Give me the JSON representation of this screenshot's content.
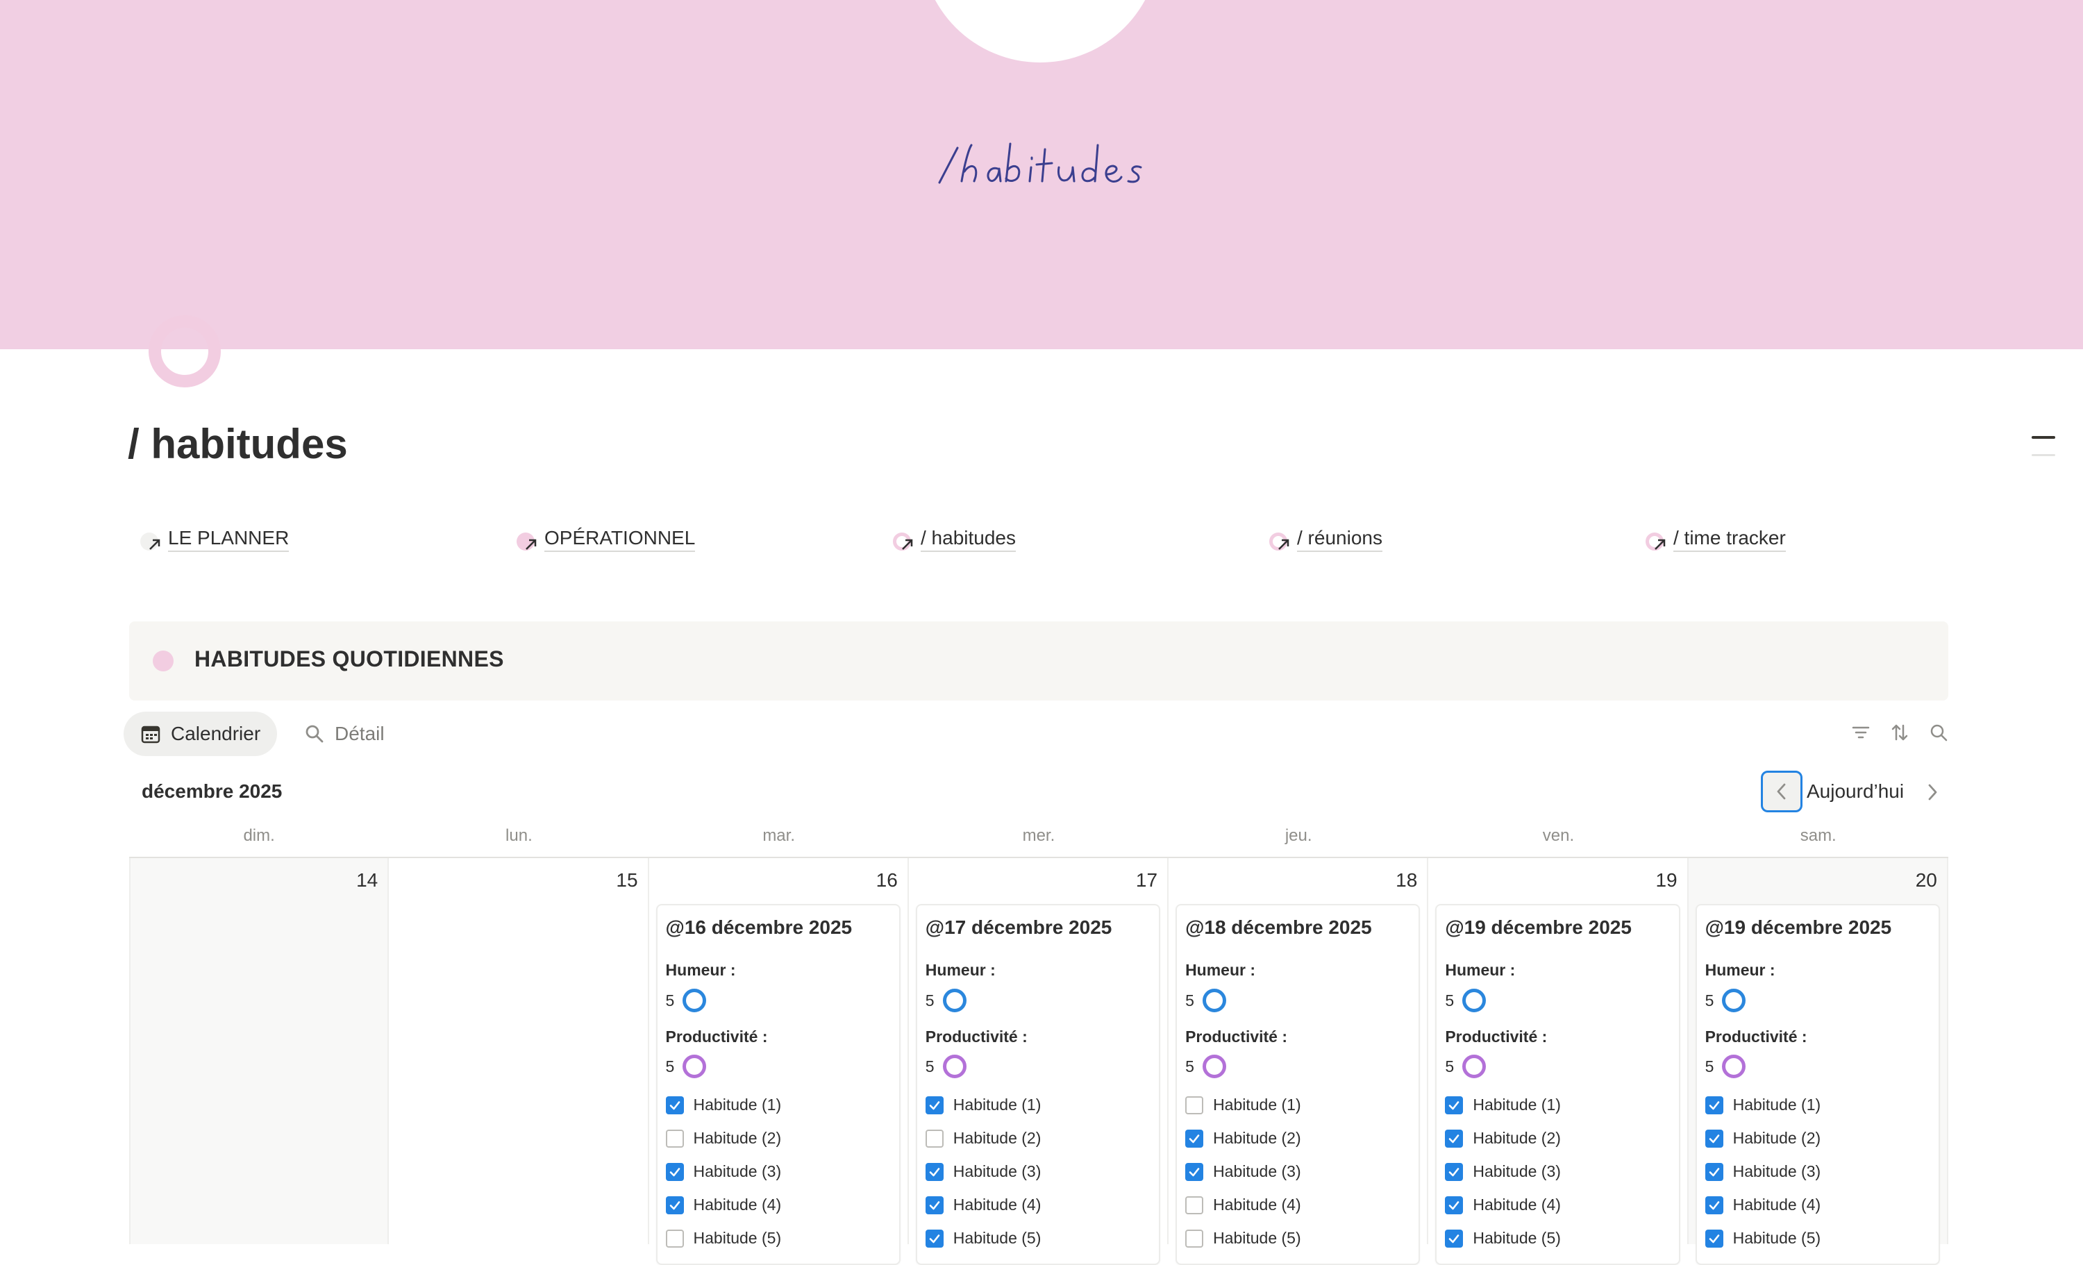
{
  "cover": {
    "script_text": "/habitudes",
    "background": "#f1cfe3"
  },
  "page": {
    "title": "/ habitudes"
  },
  "links": [
    {
      "label": "LE PLANNER",
      "icon": "circle-gray-icon"
    },
    {
      "label": "OPÉRATIONNEL",
      "icon": "circle-pink-filled-icon"
    },
    {
      "label": "/ habitudes",
      "icon": "ring-pink-icon"
    },
    {
      "label": "/ réunions",
      "icon": "ring-pink-icon"
    },
    {
      "label": "/ time tracker",
      "icon": "ring-pink-icon"
    }
  ],
  "callout": {
    "title": "HABITUDES QUOTIDIENNES"
  },
  "views": {
    "calendar": "Calendrier",
    "detail": "Détail"
  },
  "calendar": {
    "month": "décembre 2025",
    "today_label": "Aujourd’hui",
    "weekdays": [
      "dim.",
      "lun.",
      "mar.",
      "mer.",
      "jeu.",
      "ven.",
      "sam."
    ],
    "days": [
      {
        "num": "14",
        "card": null
      },
      {
        "num": "15",
        "card": null
      },
      {
        "num": "16",
        "card": {
          "title": "@16 décembre 2025",
          "humeur_label": "Humeur :",
          "humeur": "5",
          "prod_label": "Productivité :",
          "prod": "5",
          "habits": [
            {
              "label": "Habitude (1)",
              "checked": true
            },
            {
              "label": "Habitude (2)",
              "checked": false
            },
            {
              "label": "Habitude (3)",
              "checked": true
            },
            {
              "label": "Habitude (4)",
              "checked": true
            },
            {
              "label": "Habitude (5)",
              "checked": false
            }
          ]
        }
      },
      {
        "num": "17",
        "card": {
          "title": "@17 décembre 2025",
          "humeur_label": "Humeur :",
          "humeur": "5",
          "prod_label": "Productivité :",
          "prod": "5",
          "habits": [
            {
              "label": "Habitude (1)",
              "checked": true
            },
            {
              "label": "Habitude (2)",
              "checked": false
            },
            {
              "label": "Habitude (3)",
              "checked": true
            },
            {
              "label": "Habitude (4)",
              "checked": true
            },
            {
              "label": "Habitude (5)",
              "checked": true
            }
          ]
        }
      },
      {
        "num": "18",
        "card": {
          "title": "@18 décembre 2025",
          "humeur_label": "Humeur :",
          "humeur": "5",
          "prod_label": "Productivité :",
          "prod": "5",
          "habits": [
            {
              "label": "Habitude (1)",
              "checked": false
            },
            {
              "label": "Habitude (2)",
              "checked": true
            },
            {
              "label": "Habitude (3)",
              "checked": true
            },
            {
              "label": "Habitude (4)",
              "checked": false
            },
            {
              "label": "Habitude (5)",
              "checked": false
            }
          ]
        }
      },
      {
        "num": "19",
        "card": {
          "title": "@19 décembre 2025",
          "humeur_label": "Humeur :",
          "humeur": "5",
          "prod_label": "Productivité :",
          "prod": "5",
          "habits": [
            {
              "label": "Habitude (1)",
              "checked": true
            },
            {
              "label": "Habitude (2)",
              "checked": true
            },
            {
              "label": "Habitude (3)",
              "checked": true
            },
            {
              "label": "Habitude (4)",
              "checked": true
            },
            {
              "label": "Habitude (5)",
              "checked": true
            }
          ]
        }
      },
      {
        "num": "20",
        "card": {
          "title": "@19 décembre 2025",
          "humeur_label": "Humeur :",
          "humeur": "5",
          "prod_label": "Productivité :",
          "prod": "5",
          "habits": [
            {
              "label": "Habitude (1)",
              "checked": true
            },
            {
              "label": "Habitude (2)",
              "checked": true
            },
            {
              "label": "Habitude (3)",
              "checked": true
            },
            {
              "label": "Habitude (4)",
              "checked": true
            },
            {
              "label": "Habitude (5)",
              "checked": true
            }
          ]
        }
      }
    ]
  },
  "colors": {
    "accent": "#2383e2",
    "humeur_ring": "#2b87dd",
    "productivite_ring": "#b371d8",
    "pink": "#f2cde1"
  }
}
